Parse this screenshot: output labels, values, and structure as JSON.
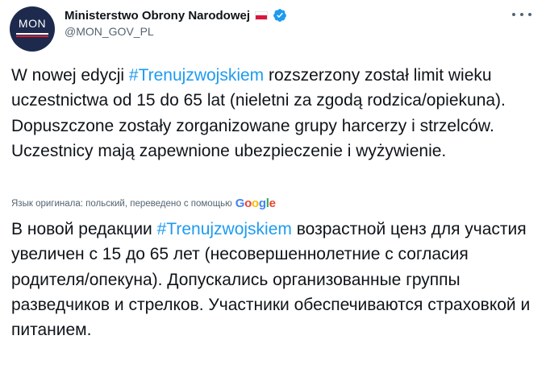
{
  "header": {
    "avatar_text": "MON",
    "display_name": "Ministerstwo Obrony Narodowej",
    "handle": "@MON_GOV_PL",
    "flag_icon": "poland-flag-icon",
    "verified_icon": "verified-badge-icon",
    "more_icon": "more-options-icon"
  },
  "tweet": {
    "original": {
      "before_hashtag": "W nowej edycji ",
      "hashtag": "#Trenujzwojskiem",
      "after_hashtag": " rozszerzony został limit wieku uczestnictwa od 15 do 65 lat (nieletni za zgodą rodzica/opiekuna). Dopuszczone zostały zorganizowane grupy harcerzy i strzelców. Uczestnicy mają zapewnione ubezpieczenie i wyżywienie."
    },
    "translation_note": "Язык оригинала: польский, переведено с помощью",
    "google_logo": {
      "g1": "G",
      "o1": "o",
      "o2": "o",
      "g2": "g",
      "l": "l",
      "e": "e"
    },
    "translated": {
      "before_hashtag": "В новой редакции ",
      "hashtag": "#Trenujzwojskiem",
      "after_hashtag": " возрастной ценз для участия увеличен с 15 до 65 лет (несовершеннолетние с согласия родителя/опекуна). Допускались организованные группы разведчиков и стрелков. Участники обеспечиваются страховкой и питанием."
    }
  },
  "colors": {
    "link": "#1d9bf0",
    "text": "#0f1419",
    "secondary": "#536471",
    "avatar_bg": "#1d2a4d",
    "verified": "#1d9bf0"
  }
}
